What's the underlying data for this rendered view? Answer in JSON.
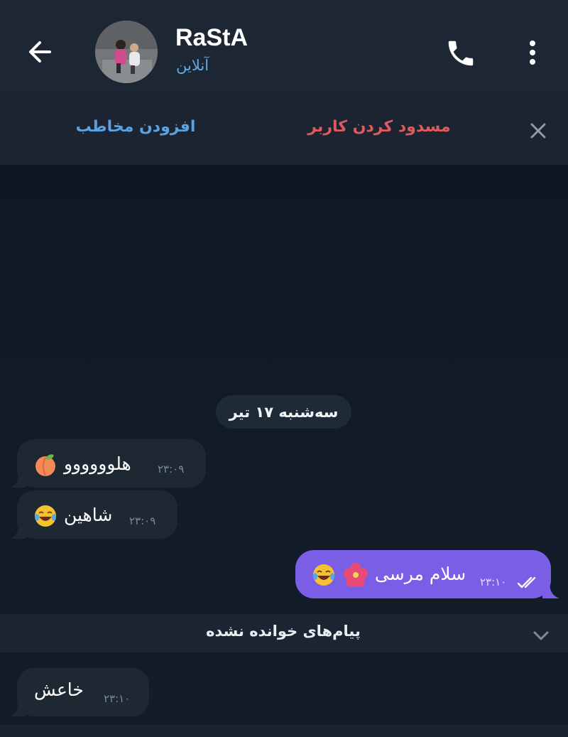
{
  "header": {
    "contact_name": "RaStA",
    "status": "آنلاین",
    "icons": {
      "back": "back-arrow-icon",
      "call": "phone-icon",
      "menu": "more-vertical-icon"
    }
  },
  "action_bar": {
    "block_user": "مسدود کردن کاربر",
    "add_contact": "افزودن مخاطب",
    "close_icon": "close-icon"
  },
  "chat": {
    "date_chip": "سه‌شنبه ۱۷ تیر",
    "messages": [
      {
        "direction": "in",
        "text": "هلوووووو",
        "emoji": "peach-emoji",
        "time": "۲۳:۰۹"
      },
      {
        "direction": "in",
        "text": "شاهین",
        "emoji": "laughing-emoji",
        "time": "۲۳:۰۹"
      },
      {
        "direction": "out",
        "text": "سلام مرسی",
        "emoji": "hibiscus-and-laughing-emoji",
        "time": "۲۳:۱۰",
        "read": true
      },
      {
        "direction": "in",
        "text": "خاعش",
        "time": "۲۳:۱۰"
      }
    ],
    "unread_label": "پیام‌های خوانده نشده"
  },
  "colors": {
    "header_bg": "#1d2733",
    "chat_bg": "#111a26",
    "incoming_bubble": "#1e2833",
    "outgoing_bubble": "#7a5fe6",
    "status_blue": "#5fa9e6",
    "block_red": "#dd5a5d",
    "add_blue": "#5aa2e0"
  }
}
